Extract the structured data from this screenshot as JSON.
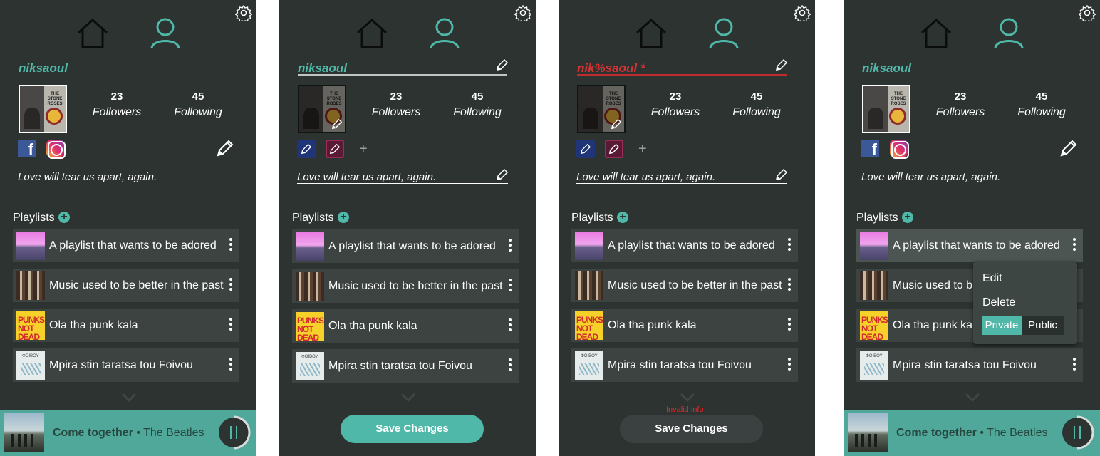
{
  "profile": {
    "username": "niksaoul",
    "username_invalid": "nik%saoul *",
    "followers_count": "23",
    "followers_label": "Followers",
    "following_count": "45",
    "following_label": "Following",
    "bio": "Love will tear us apart, again."
  },
  "playlists": {
    "header": "Playlists",
    "add_icon": "+",
    "items": [
      {
        "title": "A playlist that wants to be adored"
      },
      {
        "title": "Music used to be better in the past"
      },
      {
        "title": "Ola tha punk kala"
      },
      {
        "title": "Mpira stin taratsa tou Foivou"
      }
    ],
    "truncated_item_2": "Music used to b",
    "truncated_item_3": "Ola tha punk kal"
  },
  "cover_text": {
    "stone_roses": "THE STONE ROSES",
    "punks": "PUNKS NOT DEAD",
    "sketch": "ΦΟΙΒΟΥ"
  },
  "player": {
    "song": "Come together",
    "separator": " • ",
    "artist": "The Beatles"
  },
  "edit": {
    "save_label": "Save Changes",
    "invalid_message": "Invalid info",
    "add_social": "+"
  },
  "context_menu": {
    "edit": "Edit",
    "delete": "Delete",
    "private": "Private",
    "public": "Public"
  },
  "icons": [
    "gear-icon",
    "home-icon",
    "user-icon",
    "pencil-icon",
    "facebook-icon",
    "instagram-icon",
    "more-vert-icon",
    "chevron-down-icon",
    "pause-icon"
  ],
  "colors": {
    "background": "#2c3331",
    "accent": "#4fb8a8",
    "error": "#d23434",
    "row": "#3c4341",
    "player": "#4fa899"
  }
}
